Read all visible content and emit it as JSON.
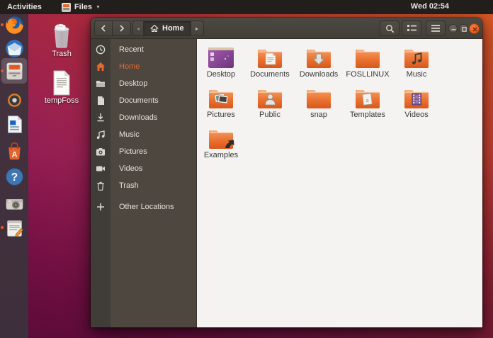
{
  "top_bar": {
    "activities": "Activities",
    "app_menu": "Files",
    "clock": "Wed 02:54"
  },
  "dock": {
    "items": [
      {
        "name": "firefox",
        "indicator": true,
        "active": false
      },
      {
        "name": "thunderbird",
        "indicator": false,
        "active": false
      },
      {
        "name": "files",
        "indicator": true,
        "active": true
      },
      {
        "name": "rhythmbox",
        "indicator": false,
        "active": false
      },
      {
        "name": "libreoffice-writer",
        "indicator": false,
        "active": false
      },
      {
        "name": "ubuntu-software",
        "indicator": false,
        "active": false
      },
      {
        "name": "help",
        "indicator": false,
        "active": false
      },
      {
        "name": "screenshot",
        "indicator": false,
        "active": false
      },
      {
        "name": "text-editor",
        "indicator": true,
        "active": false
      }
    ]
  },
  "desktop": {
    "icons": [
      {
        "label": "Trash"
      },
      {
        "label": "tempFoss"
      }
    ]
  },
  "window": {
    "header": {
      "path_current": "Home"
    },
    "sidebar": {
      "items": [
        {
          "label": "Recent"
        },
        {
          "label": "Home"
        },
        {
          "label": "Desktop"
        },
        {
          "label": "Documents"
        },
        {
          "label": "Downloads"
        },
        {
          "label": "Music"
        },
        {
          "label": "Pictures"
        },
        {
          "label": "Videos"
        },
        {
          "label": "Trash"
        },
        {
          "label": "Other Locations"
        }
      ],
      "active_item": "Home"
    },
    "files": [
      {
        "label": "Desktop"
      },
      {
        "label": "Documents"
      },
      {
        "label": "Downloads"
      },
      {
        "label": "FOSLLINUX"
      },
      {
        "label": "Music"
      },
      {
        "label": "Pictures"
      },
      {
        "label": "Public"
      },
      {
        "label": "snap"
      },
      {
        "label": "Templates"
      },
      {
        "label": "Videos"
      },
      {
        "label": "Examples"
      }
    ]
  },
  "colors": {
    "accent": "#e95420",
    "header": "#45413b",
    "sidebar": "#4d4740",
    "content_bg": "#f4f3f1"
  }
}
